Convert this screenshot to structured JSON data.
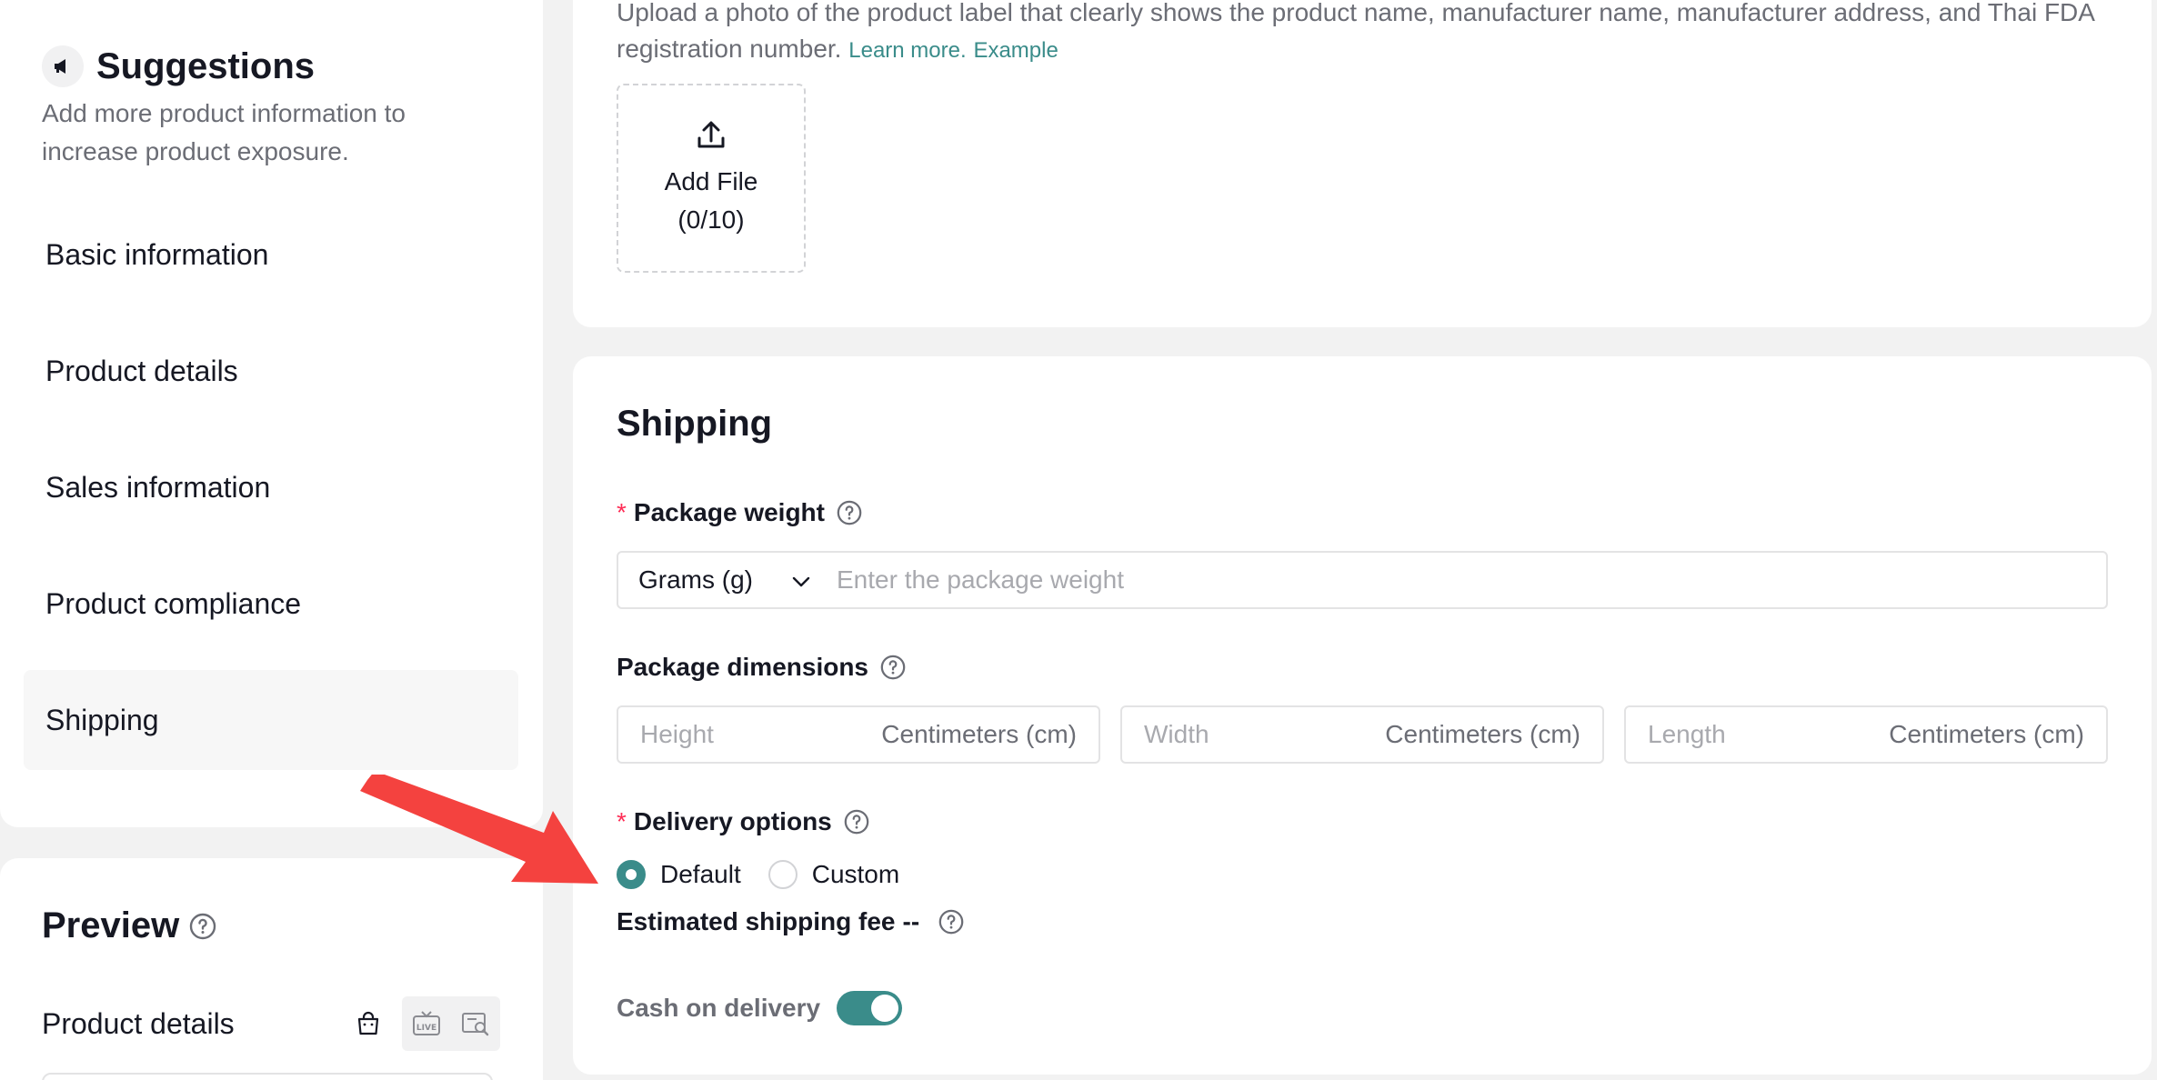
{
  "sidebar": {
    "title": "Suggestions",
    "description": "Add more product information to increase product exposure.",
    "items": [
      {
        "label": "Basic information",
        "active": false
      },
      {
        "label": "Product details",
        "active": false
      },
      {
        "label": "Sales information",
        "active": false
      },
      {
        "label": "Product compliance",
        "active": false
      },
      {
        "label": "Shipping",
        "active": true
      }
    ],
    "icon": "megaphone-icon"
  },
  "preview": {
    "title": "Preview",
    "row_label": "Product details",
    "tools": [
      "shop-bag-icon",
      "live-icon",
      "search-preview-icon"
    ]
  },
  "compliance": {
    "description": "Upload a photo of the product label that clearly shows the product name, manufacturer name, manufacturer address, and Thai FDA registration number.",
    "learn_more": "Learn more.",
    "example": "Example",
    "upload_label": "Add File",
    "upload_count": "(0/10)"
  },
  "shipping": {
    "title": "Shipping",
    "weight": {
      "label": "Package weight",
      "required": true,
      "unit": "Grams (g)",
      "placeholder": "Enter the package weight",
      "value": ""
    },
    "dimensions": {
      "label": "Package dimensions",
      "fields": [
        {
          "placeholder": "Height",
          "unit": "Centimeters (cm)"
        },
        {
          "placeholder": "Width",
          "unit": "Centimeters (cm)"
        },
        {
          "placeholder": "Length",
          "unit": "Centimeters (cm)"
        }
      ]
    },
    "delivery": {
      "label": "Delivery options",
      "required": true,
      "options": [
        {
          "label": "Default",
          "checked": true
        },
        {
          "label": "Custom",
          "checked": false
        }
      ]
    },
    "fee": {
      "label": "Estimated shipping fee",
      "value": "--"
    },
    "cod": {
      "label": "Cash on delivery",
      "enabled": true
    }
  },
  "colors": {
    "accent": "#3a8c8a",
    "required": "#fe2c55",
    "annotation_arrow": "#f4423f"
  }
}
